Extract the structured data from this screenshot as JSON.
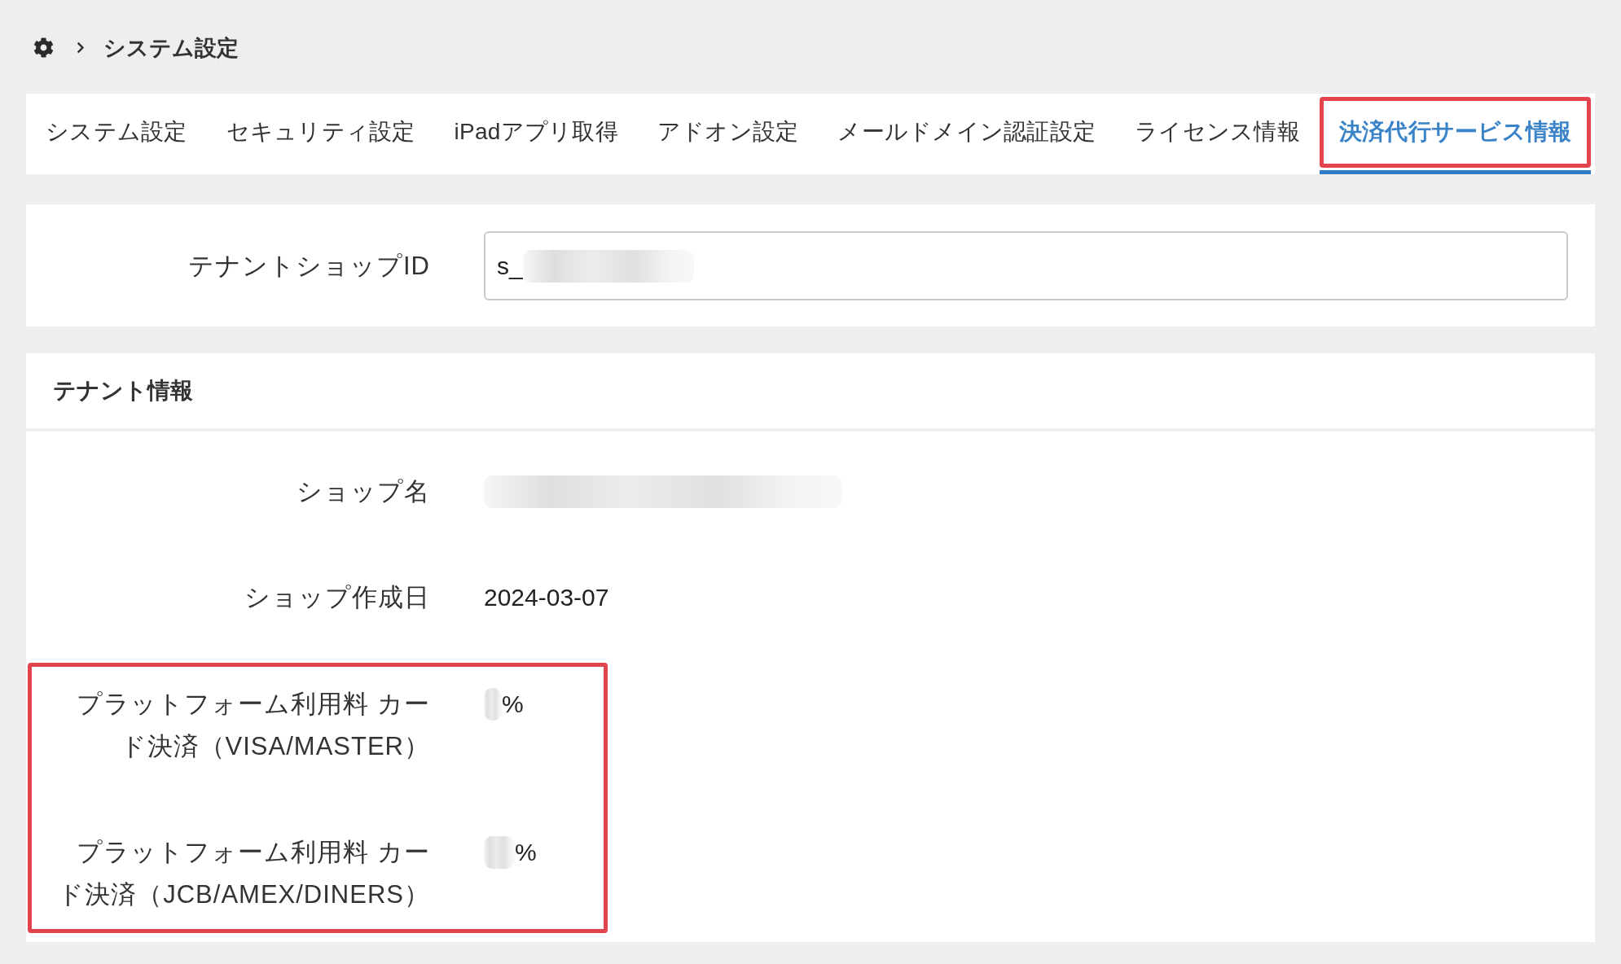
{
  "breadcrumb": {
    "current": "システム設定"
  },
  "tabs": [
    {
      "label": "システム設定",
      "selected": false,
      "highlighted": false
    },
    {
      "label": "セキュリティ設定",
      "selected": false,
      "highlighted": false
    },
    {
      "label": "iPadアプリ取得",
      "selected": false,
      "highlighted": false
    },
    {
      "label": "アドオン設定",
      "selected": false,
      "highlighted": false
    },
    {
      "label": "メールドメイン認証設定",
      "selected": false,
      "highlighted": false
    },
    {
      "label": "ライセンス情報",
      "selected": false,
      "highlighted": false
    },
    {
      "label": "決済代行サービス情報",
      "selected": true,
      "highlighted": true
    }
  ],
  "shop_id": {
    "label": "テナントショップID",
    "value": "s_",
    "redacted": true
  },
  "tenant_info": {
    "title": "テナント情報",
    "groups": [
      {
        "highlighted": false,
        "fields": [
          {
            "label_lines": [
              "ショップ名"
            ],
            "redacted": true
          },
          {
            "label_lines": [
              "ショップ作成日"
            ],
            "value": "2024-03-07"
          }
        ]
      },
      {
        "highlighted": true,
        "fields": [
          {
            "label_lines": [
              "プラットフォーム利用料 カー",
              "ド決済（VISA/MASTER）"
            ],
            "value": "%",
            "redacted": true
          },
          {
            "label_lines": [
              "プラットフォーム利用料 カー",
              "ド決済（JCB/AMEX/DINERS）"
            ],
            "value": "%",
            "redacted": true
          }
        ]
      }
    ]
  }
}
